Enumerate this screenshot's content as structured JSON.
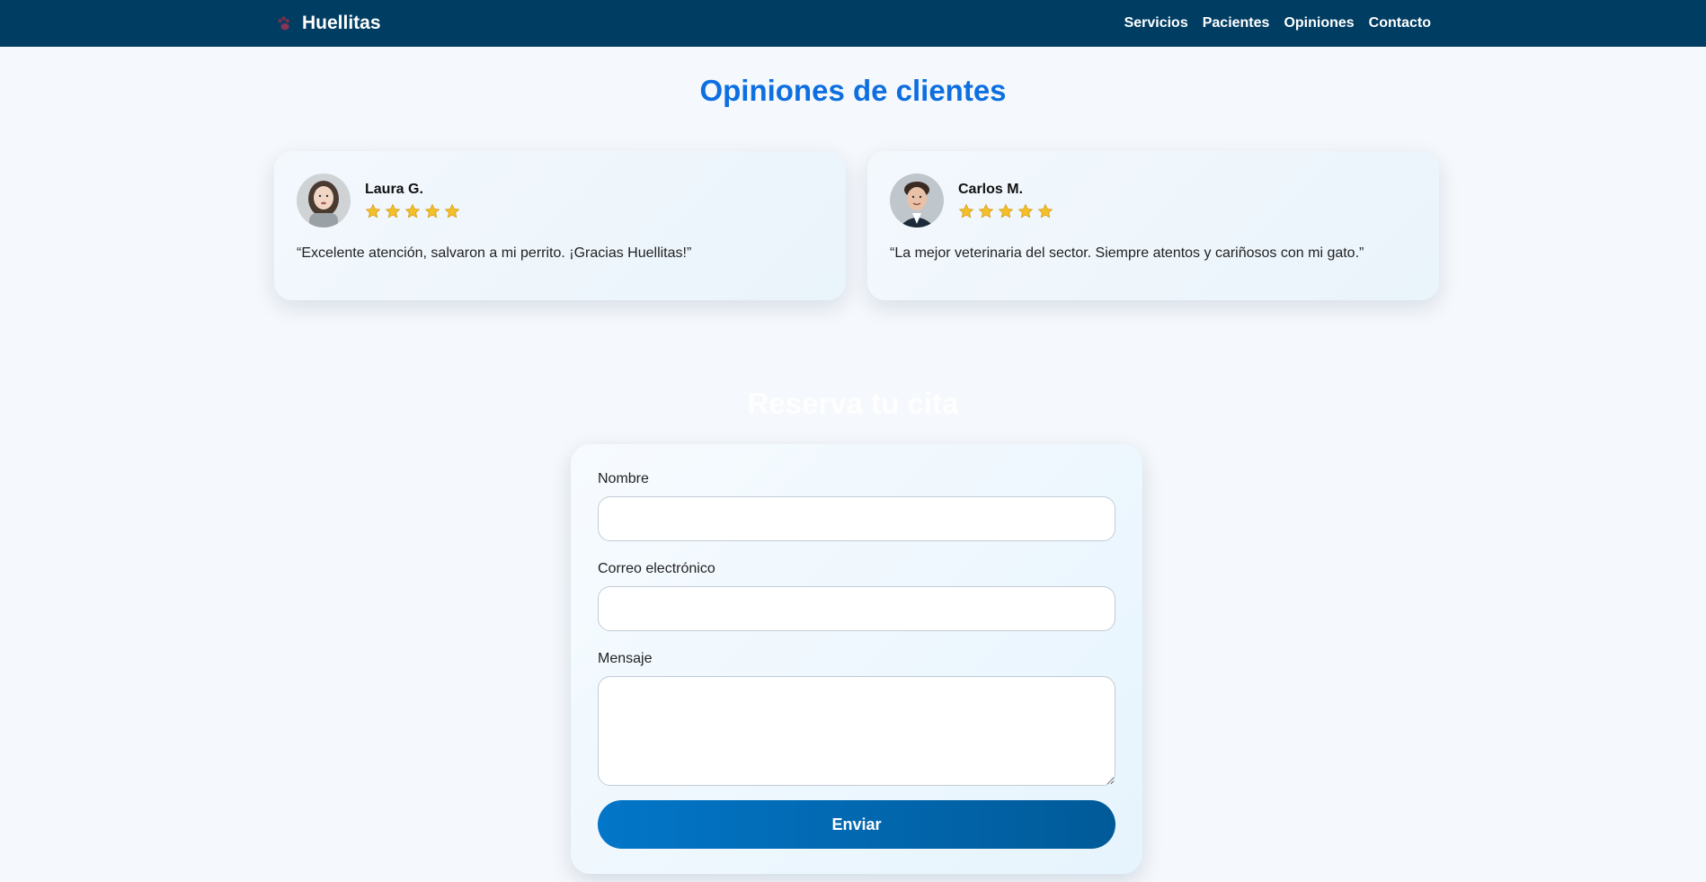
{
  "nav": {
    "brand": "Huellitas",
    "links": [
      "Servicios",
      "Pacientes",
      "Opiniones",
      "Contacto"
    ]
  },
  "reviews": {
    "title": "Opiniones de clientes",
    "items": [
      {
        "name": "Laura G.",
        "rating": 5,
        "text": "“Excelente atención, salvaron a mi perrito. ¡Gracias Huellitas!”"
      },
      {
        "name": "Carlos M.",
        "rating": 5,
        "text": "“La mejor veterinaria del sector. Siempre atentos y cariñosos con mi gato.”"
      }
    ]
  },
  "booking": {
    "title": "Reserva tu cita",
    "name_label": "Nombre",
    "email_label": "Correo electrónico",
    "message_label": "Mensaje",
    "submit_label": "Enviar"
  },
  "colors": {
    "nav_bg": "#003d63",
    "accent": "#0d6fe0",
    "button": "#0276c8",
    "star": "#f4c02a"
  }
}
